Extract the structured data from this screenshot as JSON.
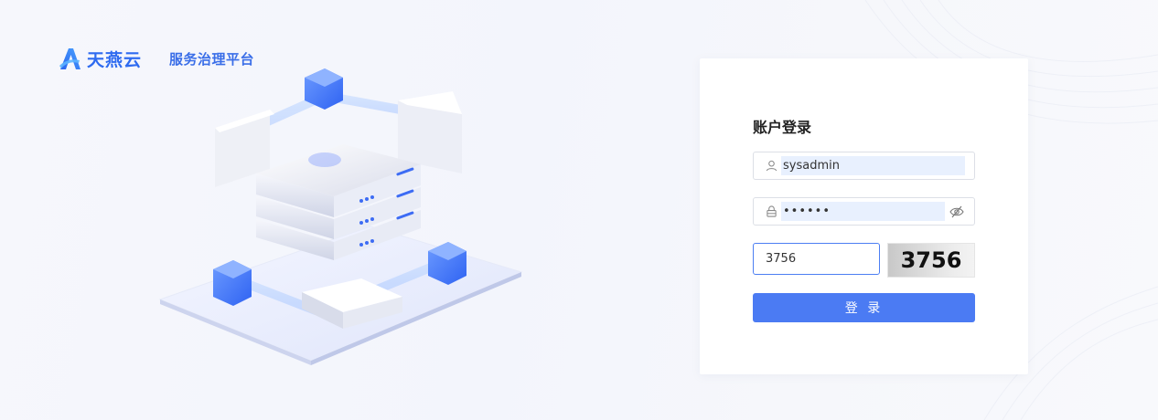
{
  "brand": {
    "name": "天燕云",
    "subtitle": "服务治理平台",
    "logo_icon": "stylized-a-logo-icon",
    "accent_color": "#2f6bf0"
  },
  "login": {
    "title": "账户登录",
    "username": {
      "icon": "user-icon",
      "value": "sysadmin"
    },
    "password": {
      "icon": "lock-icon",
      "value": "••••••",
      "toggle_icon": "eye-off-icon"
    },
    "captcha": {
      "value": "3756",
      "image_text": "3756"
    },
    "submit_label": "登 录",
    "button_color": "#4b7bf3"
  },
  "illustration": {
    "subject": "server-stack-network-illustration"
  }
}
